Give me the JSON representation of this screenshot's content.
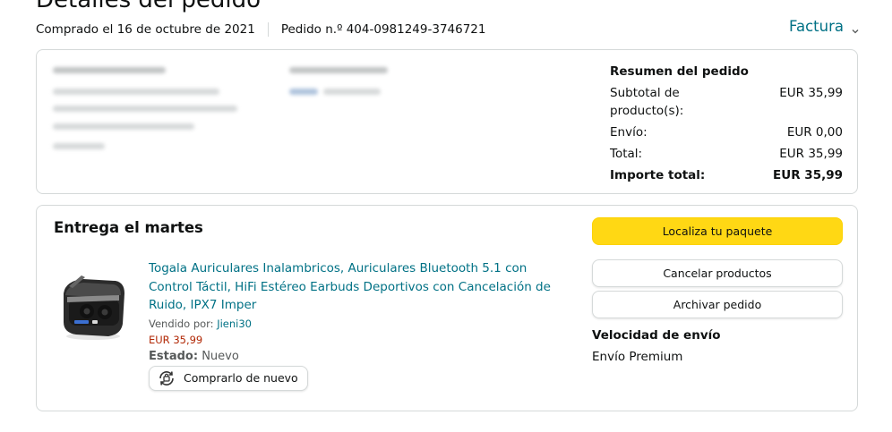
{
  "page": {
    "title": "Detalles del pedido",
    "purchase_date": "Comprado el 16 de octubre de 2021",
    "order_number": "Pedido n.º 404-0981249-3746721",
    "invoice_label": "Factura",
    "invoice_icon": "chevron-down-icon"
  },
  "summary": {
    "title": "Resumen del pedido",
    "rows": [
      {
        "label": "Subtotal de producto(s):",
        "value": "EUR 35,99"
      },
      {
        "label": "Envío:",
        "value": "EUR 0,00"
      },
      {
        "label": "Total:",
        "value": "EUR 35,99"
      }
    ],
    "grand_total_label": "Importe total:",
    "grand_total_value": "EUR 35,99"
  },
  "delivery": {
    "title": "Entrega el martes",
    "product": {
      "image_icon": "earbuds-case-image",
      "title": "Togala Auriculares Inalambricos, Auriculares Bluetooth 5.1 con Control Táctil, HiFi Estéreo Earbuds Deportivos con Cancelación de Ruido, IPX7 Imper",
      "seller_label": "Vendido por:",
      "seller_name": "Jieni30",
      "price": "EUR 35,99",
      "state_label": "Estado:",
      "state_value": "Nuevo",
      "buy_again_label": "Comprarlo de nuevo",
      "buy_again_icon": "buy-again-icon"
    },
    "actions": {
      "track_label": "Localiza tu paquete",
      "cancel_label": "Cancelar productos",
      "archive_label": "Archivar pedido"
    },
    "shipping_speed_title": "Velocidad de envío",
    "shipping_speed_value": "Envío Premium"
  },
  "colors": {
    "link": "#007185",
    "price": "#b12704",
    "primary_button": "#ffd814",
    "border": "#d5d9d9"
  }
}
